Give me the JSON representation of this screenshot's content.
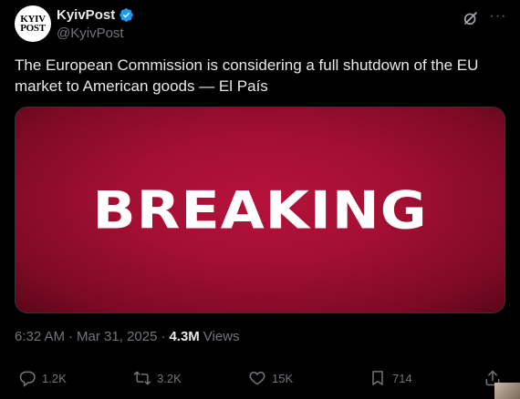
{
  "author": {
    "display_name": "KyivPost",
    "handle": "@KyivPost",
    "avatar_line1": "KYIV",
    "avatar_line2": "POST",
    "verified_color": "#1d9bf0"
  },
  "tweet": {
    "text": "The European Commission is considering a full shutdown of the EU market to American goods — El País",
    "media_text": "BREAKING"
  },
  "meta": {
    "time": "6:32 AM",
    "sep1": "·",
    "date": "Mar 31, 2025",
    "sep2": "·",
    "views_count": "4.3M",
    "views_label": "Views"
  },
  "actions": {
    "replies": "1.2K",
    "reposts": "3.2K",
    "likes": "15K",
    "bookmarks": "714"
  },
  "icons": {
    "grok": "grok-icon",
    "more": "more-icon",
    "reply": "reply-icon",
    "repost": "repost-icon",
    "like": "heart-icon",
    "bookmark": "bookmark-icon",
    "share": "share-icon"
  },
  "colors": {
    "background": "#000000",
    "text": "#e7e9ea",
    "secondary": "#71767b",
    "media_red": "#a30f33"
  }
}
